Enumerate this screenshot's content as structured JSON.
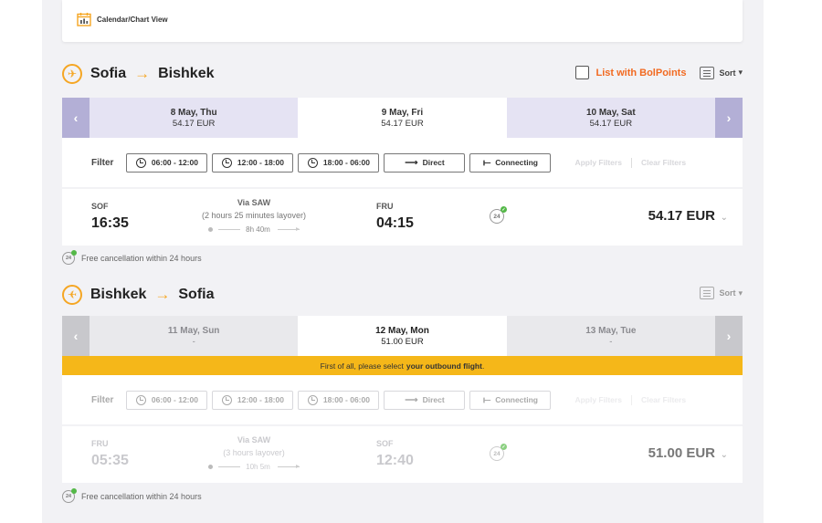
{
  "calendar_link": {
    "label": "Calendar/Chart View",
    "icon": "calendar-icon"
  },
  "outbound": {
    "from": "Sofia",
    "to": "Bishkek",
    "bolpoints_label": "List with BolPoints",
    "sort_label": "Sort",
    "dates": [
      {
        "day": "8 May, Thu",
        "price": "54.17 EUR",
        "selected": false
      },
      {
        "day": "9 May, Fri",
        "price": "54.17 EUR",
        "selected": true
      },
      {
        "day": "10 May, Sat",
        "price": "54.17 EUR",
        "selected": false
      }
    ],
    "filter": {
      "label": "Filter",
      "options": [
        "06:00 - 12:00",
        "12:00 - 18:00",
        "18:00 - 06:00",
        "Direct",
        "Connecting"
      ],
      "apply": "Apply Filters",
      "clear": "Clear Filters"
    },
    "flight": {
      "dep_code": "SOF",
      "dep_time": "16:35",
      "via": "Via SAW",
      "layover": "(2 hours 25 minutes layover)",
      "duration": "8h 40m",
      "arr_code": "FRU",
      "arr_time": "04:15",
      "badge": "24",
      "price": "54.17 EUR"
    },
    "free_cancellation": "Free cancellation within 24 hours"
  },
  "inbound": {
    "from": "Bishkek",
    "to": "Sofia",
    "sort_label": "Sort",
    "dates": [
      {
        "day": "11 May, Sun",
        "price": "-",
        "selected": false
      },
      {
        "day": "12 May, Mon",
        "price": "51.00 EUR",
        "selected": true
      },
      {
        "day": "13 May, Tue",
        "price": "-",
        "selected": false
      }
    ],
    "notice_pre": "First of all, please select",
    "notice_bold": "your outbound flight",
    "notice_post": ".",
    "filter": {
      "label": "Filter",
      "options": [
        "06:00 - 12:00",
        "12:00 - 18:00",
        "18:00 - 06:00",
        "Direct",
        "Connecting"
      ],
      "apply": "Apply Filters",
      "clear": "Clear Filters"
    },
    "flight": {
      "dep_code": "FRU",
      "dep_time": "05:35",
      "via": "Via SAW",
      "layover": "(3 hours layover)",
      "duration": "10h 5m",
      "arr_code": "SOF",
      "arr_time": "12:40",
      "badge": "24",
      "price": "51.00 EUR"
    },
    "free_cancellation": "Free cancellation within 24 hours"
  },
  "colors": {
    "accent": "#f5a623",
    "bolpoints": "#f26a21",
    "notice_bg": "#f5b719",
    "date_nav": "#b3afd6"
  }
}
